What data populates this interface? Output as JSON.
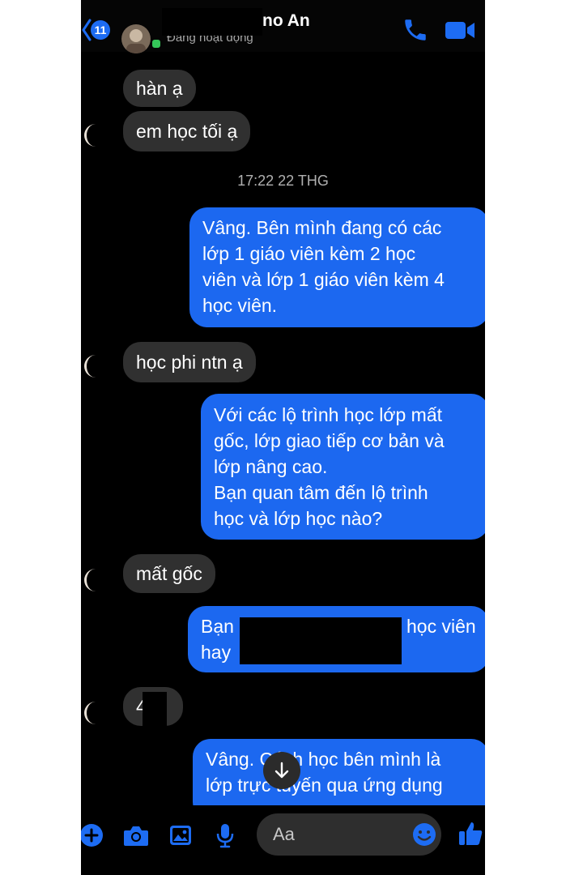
{
  "header": {
    "back_count": "11",
    "contact_name": "no An",
    "status": "Đang hoạt động"
  },
  "messages": {
    "m1": "hàn ạ",
    "m2": "em học tối ạ",
    "timestamp": "17:22 22 THG",
    "m3_lines": [
      "Vâng. Bên mình đang có các",
      "lớp 1 giáo viên kèm 2 học",
      "viên và lớp 1 giáo viên kèm 4",
      "học viên."
    ],
    "m4": "học phi ntn ạ",
    "m5_lines": [
      "Với các lộ trình học lớp mất",
      "gốc, lớp giao tiếp cơ bản và",
      "lớp nâng cao.",
      "Bạn quan tâm đến lộ trình",
      "học và lớp học nào?"
    ],
    "m6": "mất gốc",
    "m7_line1_start": "Bạn",
    "m7_line1_end": "học viên",
    "m7_line2_start": "hay",
    "m8": "4",
    "m9_lines": [
      "Vâng. Cách học bên mình là",
      "lớp trực tuyến qua ứng dụng"
    ]
  },
  "composer": {
    "placeholder": "Aa"
  },
  "colors": {
    "accent": "#1c68f0",
    "incoming_bubble": "#303030",
    "background": "#000000"
  },
  "icons": [
    "back-chevron-icon",
    "phone-icon",
    "video-camera-icon",
    "plus-icon",
    "camera-icon",
    "image-icon",
    "microphone-icon",
    "emoji-icon",
    "thumbs-up-icon",
    "arrow-down-icon"
  ]
}
